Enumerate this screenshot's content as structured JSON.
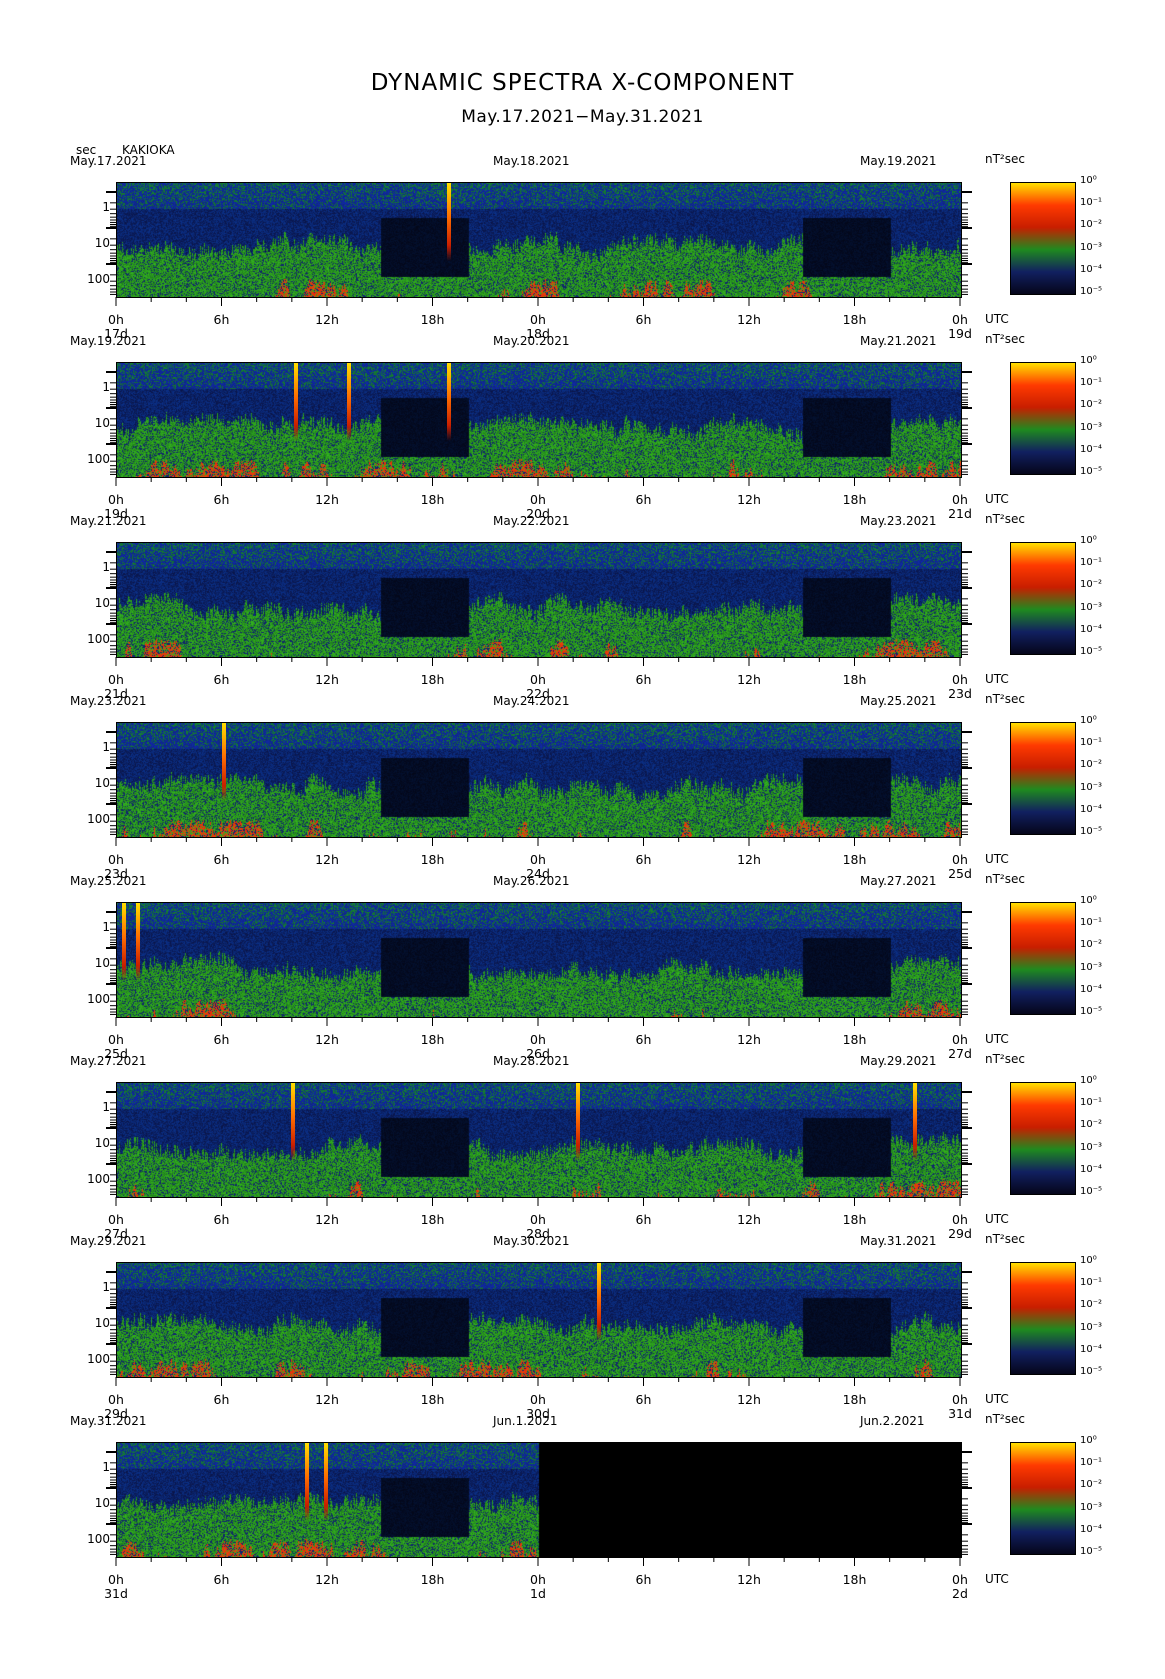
{
  "title": "DYNAMIC SPECTRA X-COMPONENT",
  "subtitle": "May.17.2021−May.31.2021",
  "ylabel": "sec",
  "station": "KAKIOKA",
  "xunit": "UTC",
  "colorbar_unit": "nT²sec",
  "y_ticks": [
    "1",
    "10",
    "100"
  ],
  "x_ticks": [
    "0h",
    "6h",
    "12h",
    "18h",
    "0h",
    "6h",
    "12h",
    "18h",
    "0h"
  ],
  "colorbar_labels": [
    "10⁰",
    "10⁻¹",
    "10⁻²",
    "10⁻³",
    "10⁻⁴",
    "10⁻⁵"
  ],
  "colorbar_colors": [
    "#ffe000",
    "#ff3a00",
    "#c81e00",
    "#1f8a1f",
    "#112060",
    "#05051a"
  ],
  "chart_data": [
    {
      "type": "heatmap",
      "date_left": "May.17.2021",
      "date_mid": "May.18.2021",
      "date_right": "May.19.2021",
      "day_labels": [
        "17d",
        "18d",
        "19d"
      ],
      "spikes_hours": [
        18.9
      ],
      "missing_from_hour": null
    },
    {
      "type": "heatmap",
      "date_left": "May.19.2021",
      "date_mid": "May.20.2021",
      "date_right": "May.21.2021",
      "day_labels": [
        "19d",
        "20d",
        "21d"
      ],
      "spikes_hours": [
        10.2,
        13.2,
        18.9
      ],
      "missing_from_hour": null
    },
    {
      "type": "heatmap",
      "date_left": "May.21.2021",
      "date_mid": "May.22.2021",
      "date_right": "May.23.2021",
      "day_labels": [
        "21d",
        "22d",
        "23d"
      ],
      "spikes_hours": [],
      "missing_from_hour": null
    },
    {
      "type": "heatmap",
      "date_left": "May.23.2021",
      "date_mid": "May.24.2021",
      "date_right": "May.25.2021",
      "day_labels": [
        "23d",
        "24d",
        "25d"
      ],
      "spikes_hours": [
        6.1
      ],
      "missing_from_hour": null
    },
    {
      "type": "heatmap",
      "date_left": "May.25.2021",
      "date_mid": "May.26.2021",
      "date_right": "May.27.2021",
      "day_labels": [
        "25d",
        "26d",
        "27d"
      ],
      "spikes_hours": [
        0.4,
        1.2
      ],
      "missing_from_hour": null
    },
    {
      "type": "heatmap",
      "date_left": "May.27.2021",
      "date_mid": "May.28.2021",
      "date_right": "May.29.2021",
      "day_labels": [
        "27d",
        "28d",
        "29d"
      ],
      "spikes_hours": [
        10.0,
        26.2,
        45.4
      ],
      "missing_from_hour": null
    },
    {
      "type": "heatmap",
      "date_left": "May.29.2021",
      "date_mid": "May.30.2021",
      "date_right": "May.31.2021",
      "day_labels": [
        "29d",
        "30d",
        "31d"
      ],
      "spikes_hours": [
        27.4
      ],
      "missing_from_hour": null
    },
    {
      "type": "heatmap",
      "date_left": "May.31.2021",
      "date_mid": "Jun.1.2021",
      "date_right": "Jun.2.2021",
      "day_labels": [
        "31d",
        "1d",
        "2d"
      ],
      "spikes_hours": [
        10.8,
        11.9
      ],
      "missing_from_hour": 24
    }
  ]
}
